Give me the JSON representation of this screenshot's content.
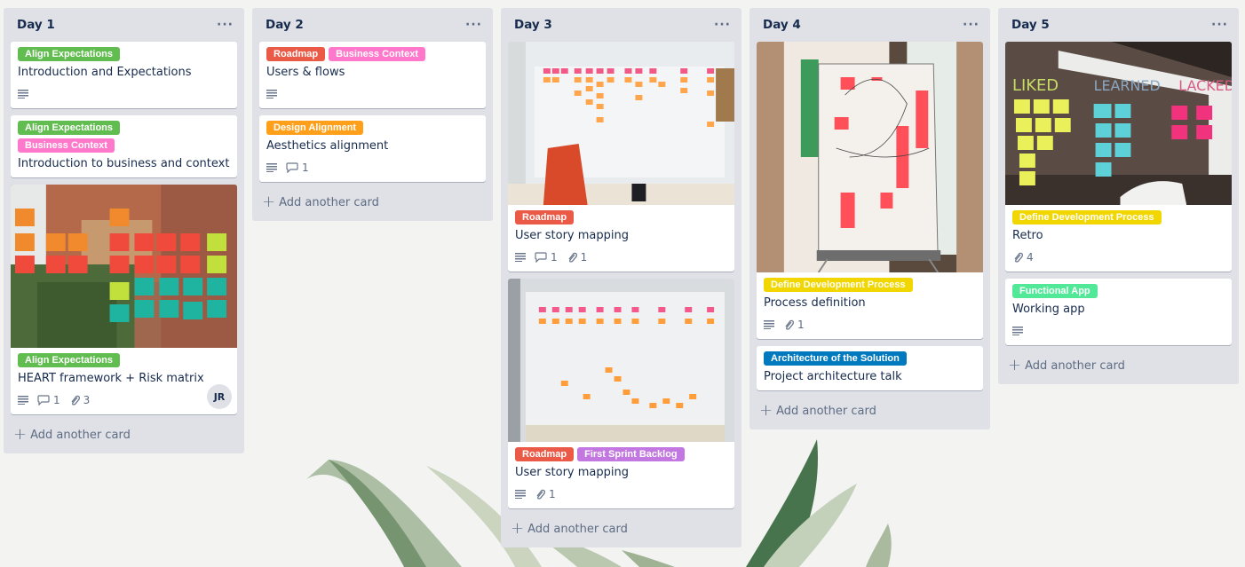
{
  "colors": {
    "green": "#61bd4f",
    "pink": "#ff78cb",
    "red": "#eb5a46",
    "orange": "#ff9f1a",
    "purple": "#c377e0",
    "yellow": "#f2d600",
    "blue": "#0079bf",
    "lime": "#51e898"
  },
  "board": {
    "add_card_label": "Add another card",
    "lists": [
      {
        "title": "Day 1",
        "menu_icon": "ellipsis-icon",
        "cards": [
          {
            "labels": [
              {
                "text": "Align Expectations",
                "color": "green"
              }
            ],
            "title": "Introduction and Expectations",
            "badges": {
              "description": true
            }
          },
          {
            "labels": [
              {
                "text": "Align Expectations",
                "color": "green"
              },
              {
                "text": "Business Context",
                "color": "pink"
              }
            ],
            "title": "Introduction to business and context"
          },
          {
            "cover": "brick-wall-sticky-notes",
            "labels": [
              {
                "text": "Align Expectations",
                "color": "green"
              }
            ],
            "title": "HEART framework + Risk matrix",
            "badges": {
              "description": true,
              "comments": "1",
              "attachments": "3"
            },
            "member": "JR"
          }
        ]
      },
      {
        "title": "Day 2",
        "menu_icon": "ellipsis-icon",
        "cards": [
          {
            "labels": [
              {
                "text": "Roadmap",
                "color": "red"
              },
              {
                "text": "Business Context",
                "color": "pink"
              }
            ],
            "title": "Users & flows",
            "badges": {
              "description": true
            }
          },
          {
            "labels": [
              {
                "text": "Design Alignment",
                "color": "orange"
              }
            ],
            "title": "Aesthetics alignment",
            "badges": {
              "description": true,
              "comments": "1"
            }
          }
        ]
      },
      {
        "title": "Day 3",
        "menu_icon": "ellipsis-icon",
        "cards": [
          {
            "cover": "whiteboard-story-map",
            "labels": [
              {
                "text": "Roadmap",
                "color": "red"
              }
            ],
            "title": "User story mapping",
            "badges": {
              "description": true,
              "comments": "1",
              "attachments": "1"
            }
          },
          {
            "cover": "whiteboard-story-map-2",
            "labels": [
              {
                "text": "Roadmap",
                "color": "red"
              },
              {
                "text": "First Sprint Backlog",
                "color": "purple"
              }
            ],
            "title": "User story mapping",
            "badges": {
              "description": true,
              "attachments": "1"
            }
          }
        ]
      },
      {
        "title": "Day 4",
        "menu_icon": "ellipsis-icon",
        "cards": [
          {
            "cover": "flipchart-process",
            "labels": [
              {
                "text": "Define Development Process",
                "color": "yellow"
              }
            ],
            "title": "Process definition",
            "badges": {
              "description": true,
              "attachments": "1"
            }
          },
          {
            "labels": [
              {
                "text": "Architecture of the Solution",
                "color": "blue"
              }
            ],
            "title": "Project architecture talk"
          }
        ]
      },
      {
        "title": "Day 5",
        "menu_icon": "ellipsis-icon",
        "cards": [
          {
            "cover": "glass-wall-retro",
            "labels": [
              {
                "text": "Define Development Process",
                "color": "yellow"
              }
            ],
            "title": "Retro",
            "badges": {
              "attachments": "4"
            }
          },
          {
            "labels": [
              {
                "text": "Functional App",
                "color": "lime"
              }
            ],
            "title": "Working app",
            "badges": {
              "description": true
            }
          }
        ]
      }
    ]
  }
}
